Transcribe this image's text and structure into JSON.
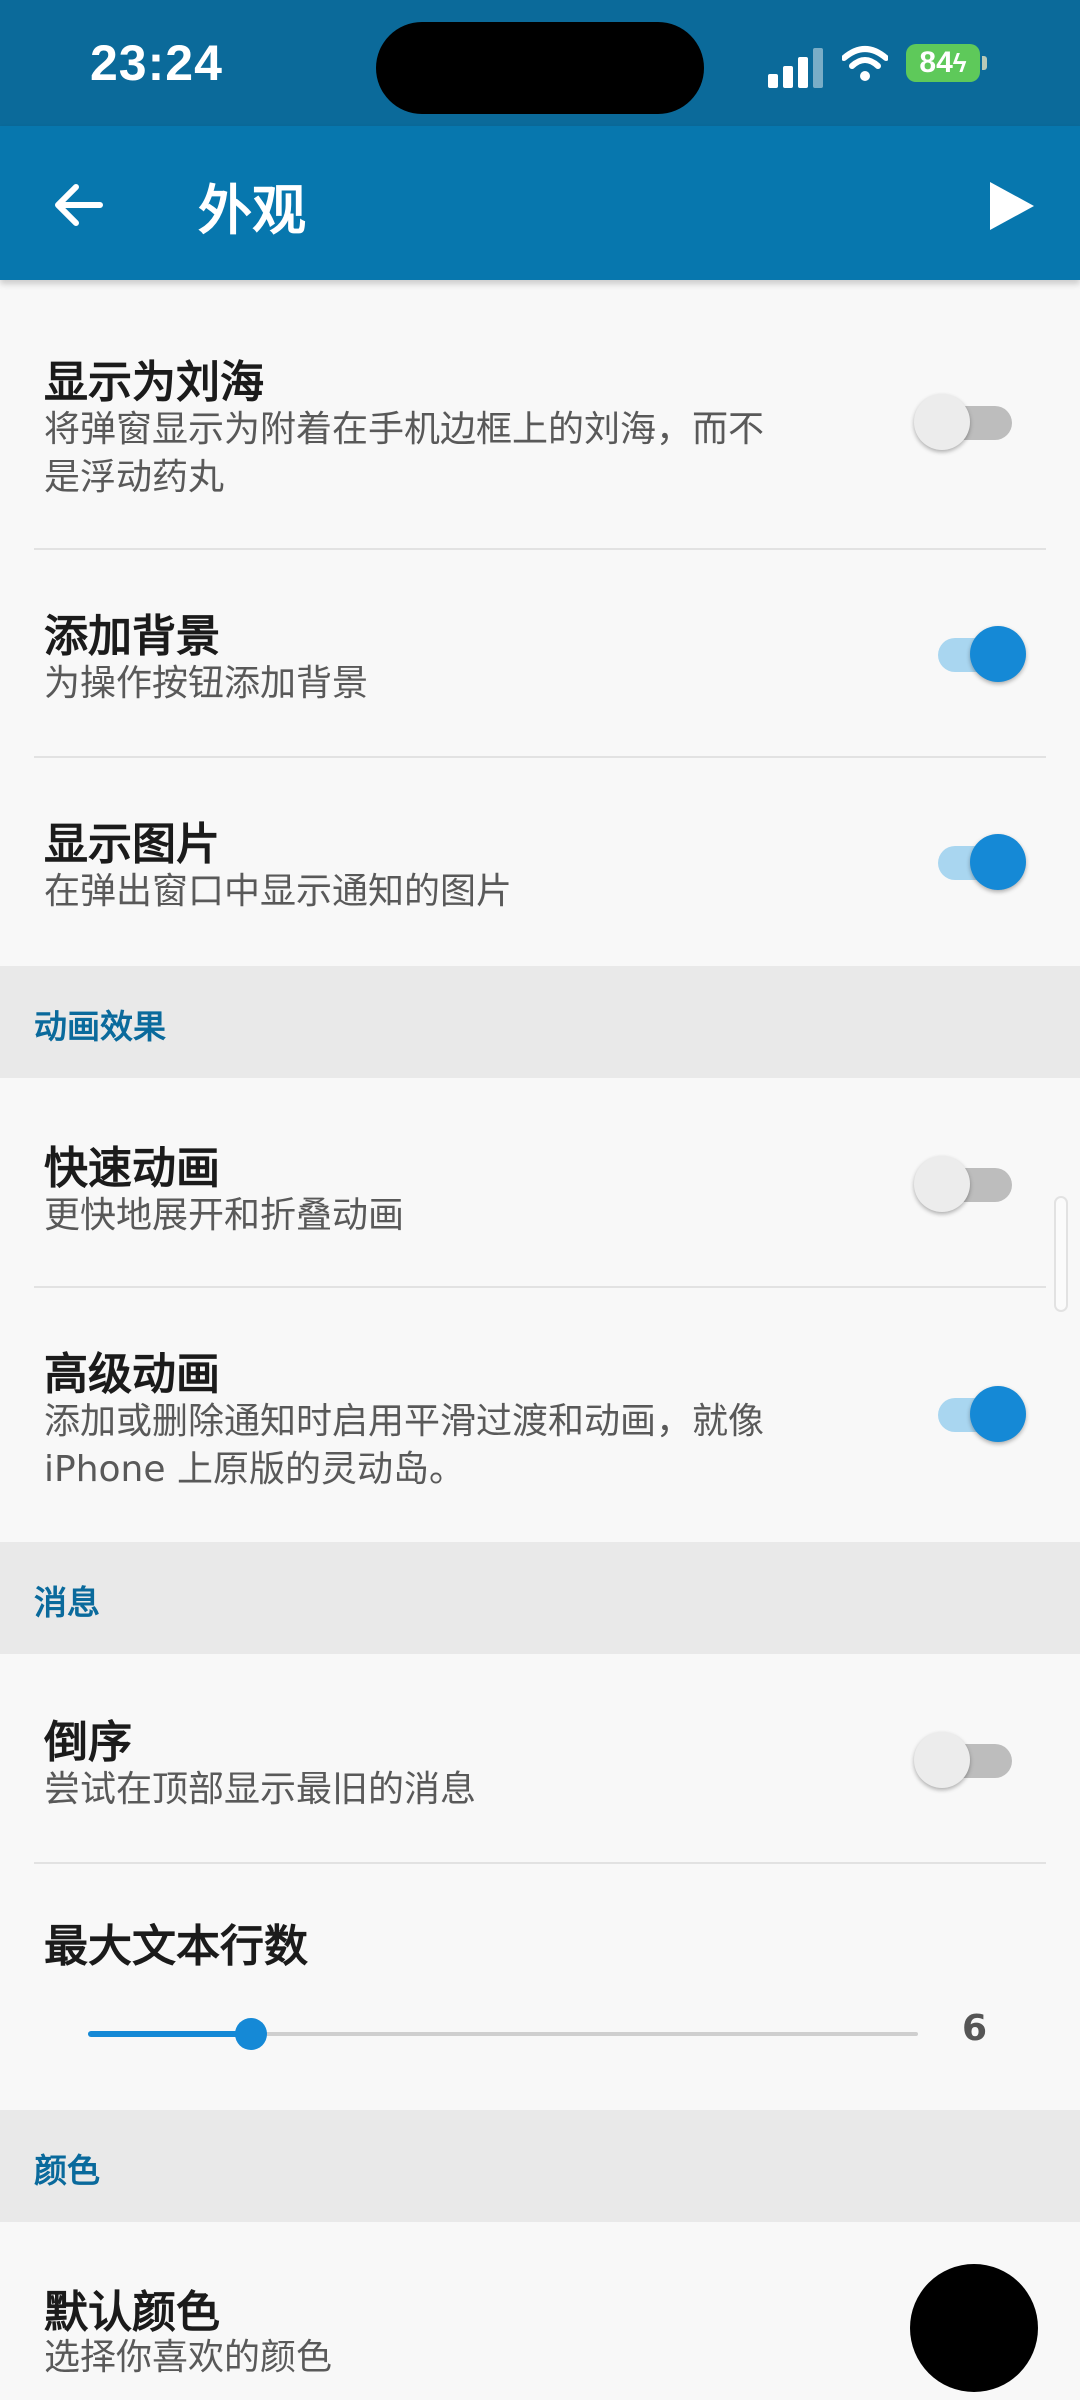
{
  "status_bar": {
    "time": "23:24",
    "battery": "84"
  },
  "app_bar": {
    "title": "外观"
  },
  "items": {
    "notch": {
      "title": "显示为刘海",
      "subtitle_line1": "将弹窗显示为附着在手机边框上的刘海，而不",
      "subtitle_line2": "是浮动药丸",
      "enabled": false
    },
    "background": {
      "title": "添加背景",
      "subtitle": "为操作按钮添加背景",
      "enabled": true
    },
    "images": {
      "title": "显示图片",
      "subtitle": "在弹出窗口中显示通知的图片",
      "enabled": true
    },
    "fast_anim": {
      "title": "快速动画",
      "subtitle": "更快地展开和折叠动画",
      "enabled": false
    },
    "adv_anim": {
      "title": "高级动画",
      "subtitle_line1": "添加或删除通知时启用平滑过渡和动画，就像",
      "subtitle_line2": "iPhone 上原版的灵动岛。",
      "enabled": true
    },
    "reverse": {
      "title": "倒序",
      "subtitle": "尝试在顶部显示最旧的消息",
      "enabled": false
    },
    "max_lines": {
      "title": "最大文本行数",
      "value": "6",
      "fill_fraction": 0.196
    },
    "default_color": {
      "title": "默认颜色",
      "subtitle": "选择你喜欢的颜色",
      "color": "#000000"
    }
  },
  "sections": {
    "animation": "动画效果",
    "messages": "消息",
    "colors": "颜色"
  },
  "colors": {
    "status_bar": "#0b6a9a",
    "app_bar": "#0777ae",
    "accent": "#1589d6",
    "section_text": "#0a6a9c"
  }
}
